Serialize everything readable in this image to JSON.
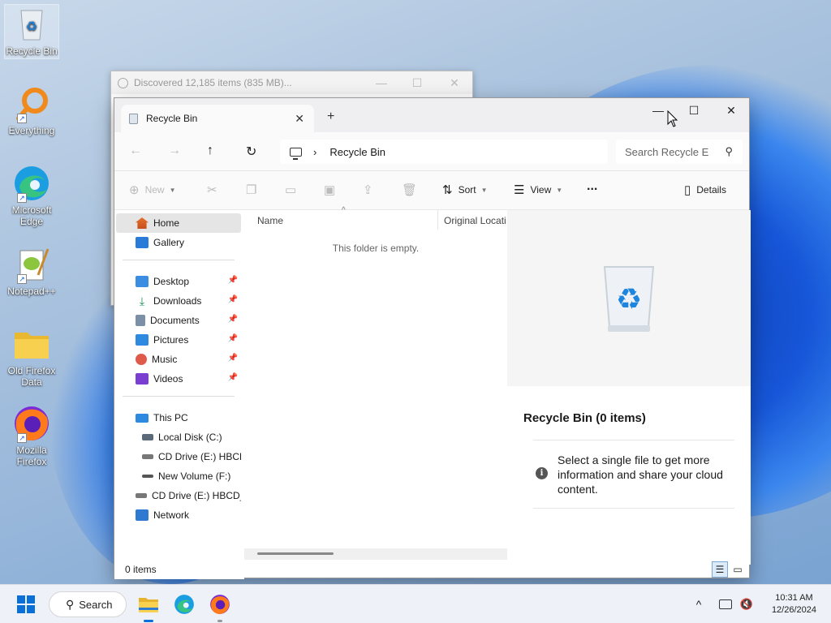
{
  "desktop": {
    "icons": [
      {
        "label": "Recycle Bin",
        "icon": "recycle-bin-icon"
      },
      {
        "label": "Everything",
        "icon": "everything-icon"
      },
      {
        "label": "Microsoft Edge",
        "icon": "edge-icon"
      },
      {
        "label": "Notepad++",
        "icon": "notepadpp-icon"
      },
      {
        "label": "Old Firefox Data",
        "icon": "folder-icon"
      },
      {
        "label": "Mozilla Firefox",
        "icon": "firefox-icon"
      }
    ]
  },
  "background_window": {
    "title": "Discovered 12,185 items (835 MB)..."
  },
  "explorer": {
    "tab_title": "Recycle Bin",
    "address": {
      "location": "Recycle Bin",
      "search_placeholder": "Search Recycle E"
    },
    "commands": {
      "new": "New",
      "sort": "Sort",
      "view": "View",
      "more": "...",
      "details": "Details"
    },
    "nav": {
      "top": [
        {
          "label": "Home"
        },
        {
          "label": "Gallery"
        }
      ],
      "pinned": [
        {
          "label": "Desktop"
        },
        {
          "label": "Downloads"
        },
        {
          "label": "Documents"
        },
        {
          "label": "Pictures"
        },
        {
          "label": "Music"
        },
        {
          "label": "Videos"
        }
      ],
      "pc": [
        {
          "label": "This PC"
        },
        {
          "label": "Local Disk (C:)"
        },
        {
          "label": "CD Drive (E:) HBCD"
        },
        {
          "label": "New Volume (F:)"
        },
        {
          "label": "CD Drive (E:) HBCD_I"
        },
        {
          "label": "Network"
        }
      ]
    },
    "columns": {
      "name": "Name",
      "original_location": "Original Locati"
    },
    "empty_message": "This folder is empty.",
    "preview": {
      "title": "Recycle Bin (0 items)",
      "info": "Select a single file to get more information and share your cloud content."
    },
    "status": {
      "items": "0 items"
    }
  },
  "taskbar": {
    "search_label": "Search",
    "time": "10:31 AM",
    "date": "12/26/2024"
  },
  "colors": {
    "accent": "#0067c0",
    "win_blue": "#1f6fe0"
  }
}
